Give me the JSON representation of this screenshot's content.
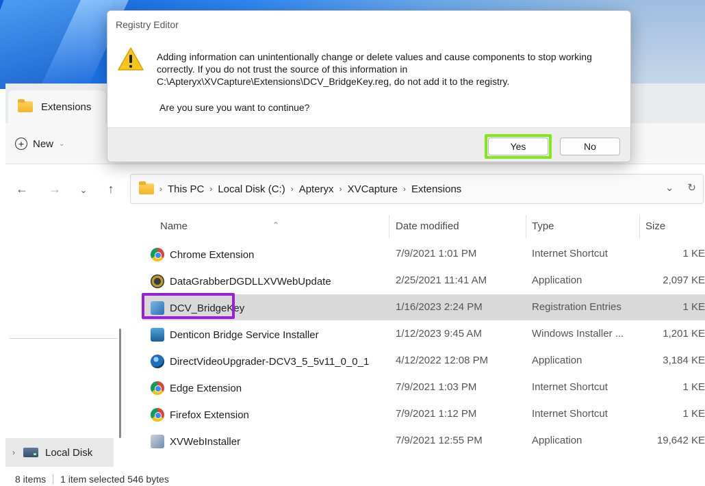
{
  "dialog": {
    "title": "Registry Editor",
    "message": "Adding information can unintentionally change or delete values and cause components to stop working correctly. If you do not trust the source of this information in C:\\Apteryx\\XVCapture\\Extensions\\DCV_BridgeKey.reg, do not add it to the registry.",
    "question": "Are you sure you want to continue?",
    "yes_label": "Yes",
    "no_label": "No",
    "icon": "warning-icon"
  },
  "explorer": {
    "tab_label": "Extensions",
    "new_label": "New",
    "breadcrumb": [
      "This PC",
      "Local Disk (C:)",
      "Apteryx",
      "XVCapture",
      "Extensions"
    ],
    "columns": {
      "name": "Name",
      "date": "Date modified",
      "type": "Type",
      "size": "Size"
    },
    "files": [
      {
        "name": "Chrome Extension",
        "date": "7/9/2021 1:01 PM",
        "type": "Internet Shortcut",
        "size": "1 KE",
        "icon": "chrome-icon"
      },
      {
        "name": "DataGrabberDGDLLXVWebUpdate",
        "date": "2/25/2021 11:41 AM",
        "type": "Application",
        "size": "2,097 KE",
        "icon": "gear-app-icon"
      },
      {
        "name": "DCV_BridgeKey",
        "date": "1/16/2023 2:24 PM",
        "type": "Registration Entries",
        "size": "1 KE",
        "icon": "registry-file-icon",
        "selected": true
      },
      {
        "name": "Denticon Bridge Service Installer",
        "date": "1/12/2023 9:45 AM",
        "type": "Windows Installer ...",
        "size": "1,201 KE",
        "icon": "installer-icon"
      },
      {
        "name": "DirectVideoUpgrader-DCV3_5_5v11_0_0_1",
        "date": "4/12/2022 12:08 PM",
        "type": "Application",
        "size": "3,184 KE",
        "icon": "globe-app-icon"
      },
      {
        "name": "Edge Extension",
        "date": "7/9/2021 1:03 PM",
        "type": "Internet Shortcut",
        "size": "1 KE",
        "icon": "chrome-icon"
      },
      {
        "name": "Firefox Extension",
        "date": "7/9/2021 1:12 PM",
        "type": "Internet Shortcut",
        "size": "1 KE",
        "icon": "chrome-icon"
      },
      {
        "name": "XVWebInstaller",
        "date": "7/9/2021 12:55 PM",
        "type": "Application",
        "size": "19,642 KE",
        "icon": "box-app-icon"
      }
    ],
    "nav_item": "Local Disk",
    "status": {
      "count": "8 items",
      "selection": "1 item selected  546 bytes"
    }
  },
  "colors": {
    "yes_highlight": "#84e61e",
    "selected_highlight": "#9b1fd8",
    "selected_row": "#d9d9d9"
  }
}
